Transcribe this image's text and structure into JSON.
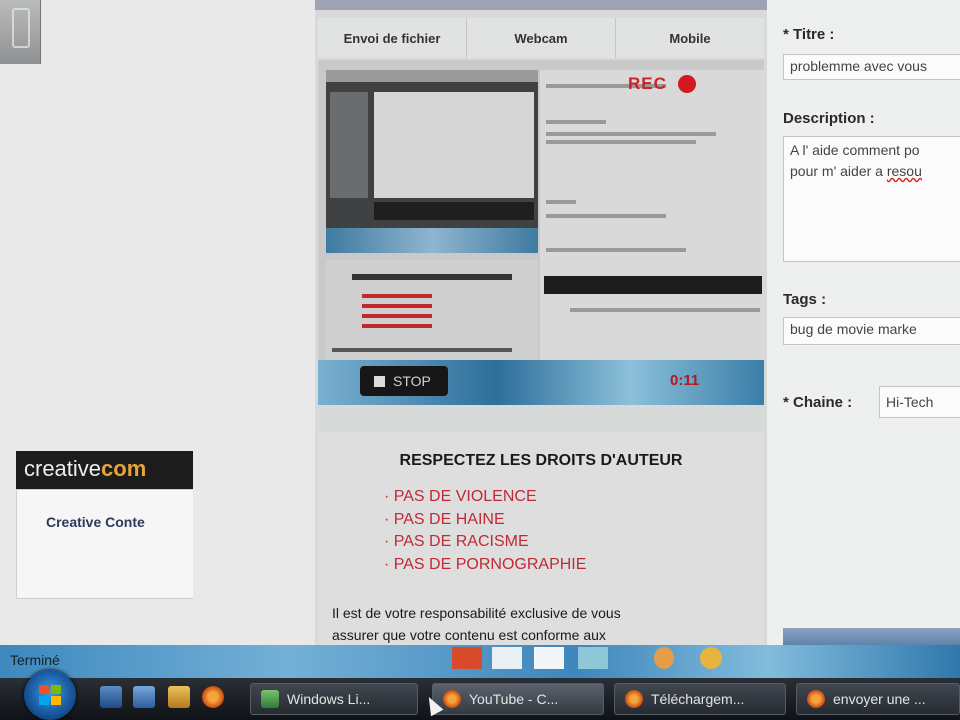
{
  "upload": {
    "tabs": [
      "Envoi de fichier",
      "Webcam",
      "Mobile"
    ],
    "rec_label": "REC",
    "stop_label": "STOP",
    "timer": "0:11"
  },
  "notice": {
    "title": "RESPECTEZ LES DROITS D'AUTEUR",
    "rules": [
      "· PAS DE VIOLENCE",
      "· PAS DE HAINE",
      "· PAS DE RACISME",
      "· PAS DE PORNOGRAPHIE"
    ],
    "body_line1": "Il est de votre responsabilité exclusive de vous",
    "body_line2": "assurer que votre contenu est conforme aux"
  },
  "form": {
    "title_label": "* Titre :",
    "title_value": "problemme avec vous",
    "description_label": "Description :",
    "description_line1": "A l' aide comment po",
    "description_line2_a": "pour m' aider a ",
    "description_line2_b": "resou",
    "tags_label": "Tags :",
    "tags_value": "bug de movie marke",
    "channel_label": "* Chaine :",
    "channel_value": "Hi-Tech",
    "cc_banner_a": "creative",
    "cc_banner_b": "com",
    "cc_link": "Creative Conte"
  },
  "statusbar": {
    "text": "Terminé"
  },
  "taskbar": {
    "tasks": [
      "Windows Li...",
      "YouTube - C...",
      "Téléchargem...",
      "envoyer une ..."
    ]
  },
  "colors": {
    "accent_red": "#c12a34",
    "rec_red": "#d11a22",
    "taskbar": "#1a1e23"
  },
  "icons": [
    "folder-icon",
    "firefox-icon",
    "windows-start-icon",
    "stop-square-icon"
  ]
}
